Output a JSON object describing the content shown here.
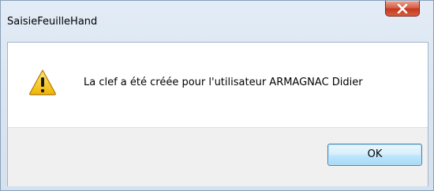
{
  "window": {
    "title": "SaisieFeuilleHand"
  },
  "titlebar": {
    "close_icon": "close-icon"
  },
  "dialog": {
    "icon": "warning-icon",
    "message": "La clef a été créée pour l'utilisateur ARMAGNAC Didier"
  },
  "buttons": {
    "ok_label": "OK"
  },
  "colors": {
    "close_button": "#c94a2e",
    "ok_border": "#3c7fb1",
    "warning_fill": "#f5c400"
  }
}
